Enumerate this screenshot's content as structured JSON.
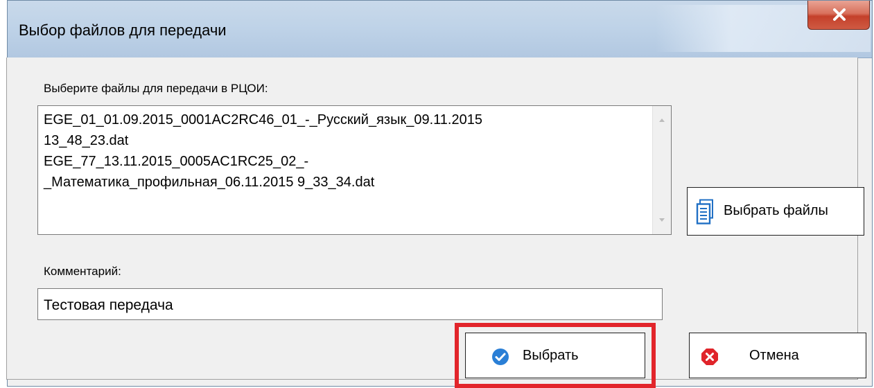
{
  "window": {
    "title": "Выбор файлов для передачи",
    "close_glyph": "X"
  },
  "files": {
    "label": "Выберите  файлы для передачи в РЦОИ:",
    "lines": [
      "EGE_01_01.09.2015_0001AC2RC46_01_-_Русский_язык_09.11.2015",
      "13_48_23.dat",
      "EGE_77_13.11.2015_0005AC1RC25_02_-",
      "_Математика_профильная_06.11.2015 9_33_34.dat"
    ]
  },
  "buttons": {
    "choose_files": "Выбрать файлы",
    "select": "Выбрать",
    "cancel": "Отмена"
  },
  "comment": {
    "label": "Комментарий:",
    "value": "Тестовая передача"
  },
  "icons": {
    "choose_files": "document-icon",
    "select": "checkmark-circle-icon",
    "cancel": "cancel-octagon-icon"
  },
  "colors": {
    "highlight": "#e2252b",
    "select_icon": "#2a7fd6",
    "cancel_icon": "#e0242a",
    "close_button": "#c94a36"
  }
}
